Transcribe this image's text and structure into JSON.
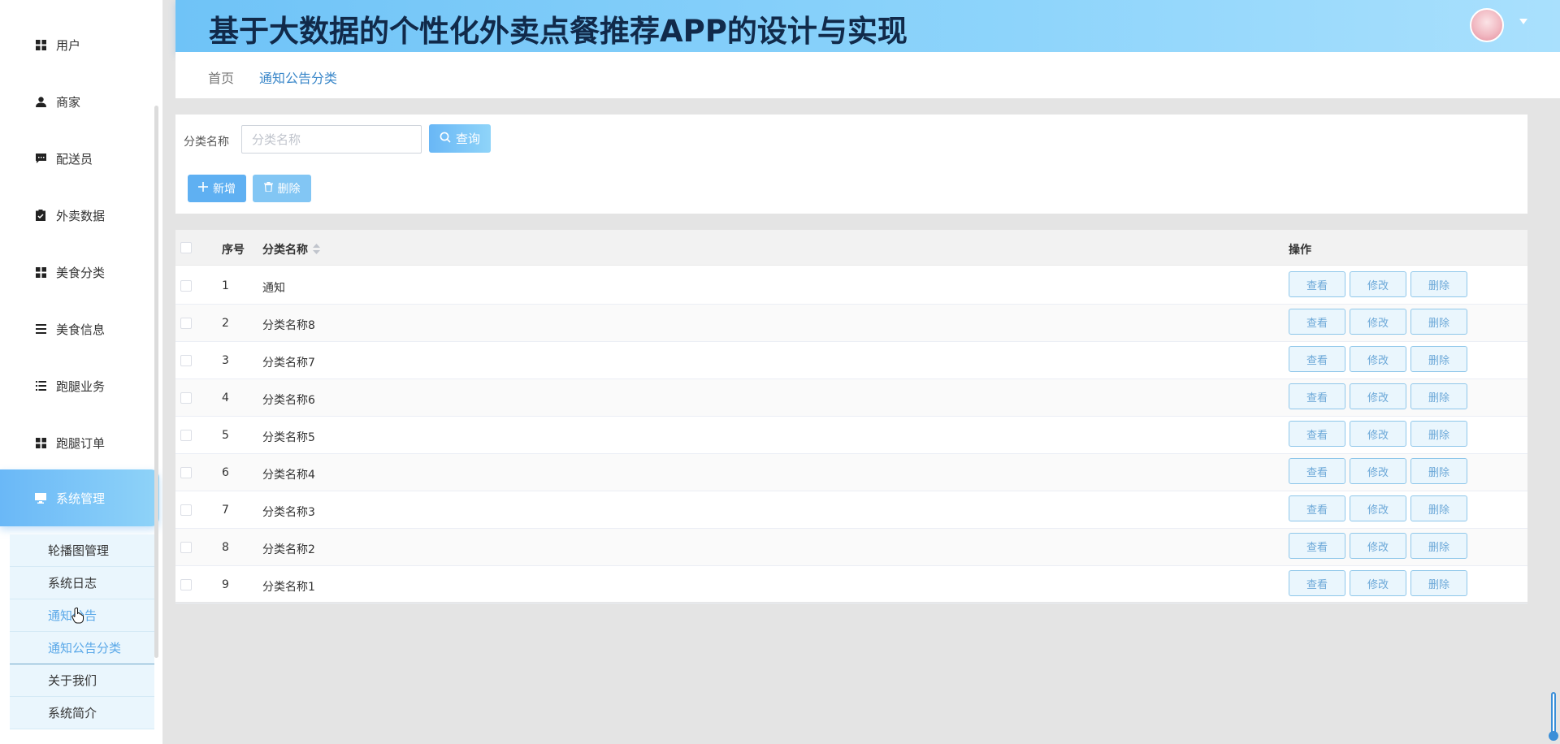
{
  "header": {
    "title": "基于大数据的个性化外卖点餐推荐APP的设计与实现"
  },
  "sidebar": {
    "items": [
      {
        "label": "用户",
        "icon": "grid-icon"
      },
      {
        "label": "商家",
        "icon": "person-icon"
      },
      {
        "label": "配送员",
        "icon": "chat-icon"
      },
      {
        "label": "外卖数据",
        "icon": "clipboard-icon"
      },
      {
        "label": "美食分类",
        "icon": "grid-icon"
      },
      {
        "label": "美食信息",
        "icon": "list-icon"
      },
      {
        "label": "跑腿业务",
        "icon": "list-icon"
      },
      {
        "label": "跑腿订单",
        "icon": "grid-icon"
      },
      {
        "label": "系统管理",
        "icon": "monitor-icon"
      }
    ],
    "submenu": [
      "轮播图管理",
      "系统日志",
      "通知公告",
      "通知公告分类",
      "关于我们",
      "系统简介"
    ]
  },
  "breadcrumb": {
    "home": "首页",
    "current": "通知公告分类"
  },
  "search": {
    "label": "分类名称",
    "placeholder": "分类名称",
    "query_label": "查询"
  },
  "toolbar": {
    "add_label": "新增",
    "delete_label": "删除"
  },
  "table": {
    "headers": {
      "index": "序号",
      "name": "分类名称",
      "actions": "操作"
    },
    "rows": [
      {
        "index": "1",
        "name": "通知"
      },
      {
        "index": "2",
        "name": "分类名称8"
      },
      {
        "index": "3",
        "name": "分类名称7"
      },
      {
        "index": "4",
        "name": "分类名称6"
      },
      {
        "index": "5",
        "name": "分类名称5"
      },
      {
        "index": "6",
        "name": "分类名称4"
      },
      {
        "index": "7",
        "name": "分类名称3"
      },
      {
        "index": "8",
        "name": "分类名称2"
      },
      {
        "index": "9",
        "name": "分类名称1"
      }
    ],
    "actions": {
      "view": "查看",
      "edit": "修改",
      "delete": "删除"
    }
  },
  "colors": {
    "accent": "#6ab8f7",
    "title": "#112a4a",
    "link": "#3a87c9"
  }
}
